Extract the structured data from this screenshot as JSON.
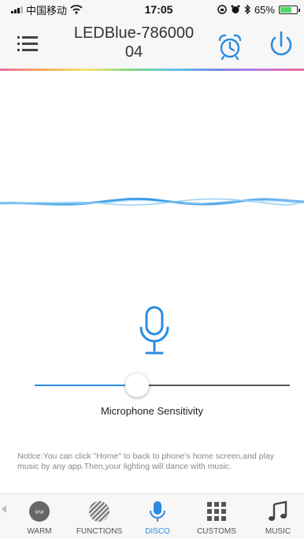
{
  "status_bar": {
    "carrier": "中国移动",
    "time": "17:05",
    "battery_text": "65%",
    "battery_level": 0.65
  },
  "header": {
    "title_line1": "LEDBlue-786000",
    "title_line2": "04",
    "menu_icon": "menu-list-icon",
    "alarm_icon": "alarm-clock-icon",
    "power_icon": "power-icon"
  },
  "colors": {
    "accent": "#2b8be0",
    "wave": "#3a9be8",
    "background": "#ffffff"
  },
  "microphone": {
    "icon": "microphone-icon",
    "sensitivity_label": "Microphone Sensitivity",
    "sensitivity_value": 0.4
  },
  "notice": "Notice:You can click \"Home\" to back to phone's home screen,and play music by any app.Then,your lighting will dance with music.",
  "tabs": [
    {
      "label": "WARM",
      "icon": "warm-circle-icon"
    },
    {
      "label": "FUNCTIONS",
      "icon": "functions-stripes-icon"
    },
    {
      "label": "DISCO",
      "icon": "microphone-icon",
      "active": true
    },
    {
      "label": "CUSTOMS",
      "icon": "grid-icon"
    },
    {
      "label": "MUSIC",
      "icon": "music-note-icon"
    }
  ]
}
